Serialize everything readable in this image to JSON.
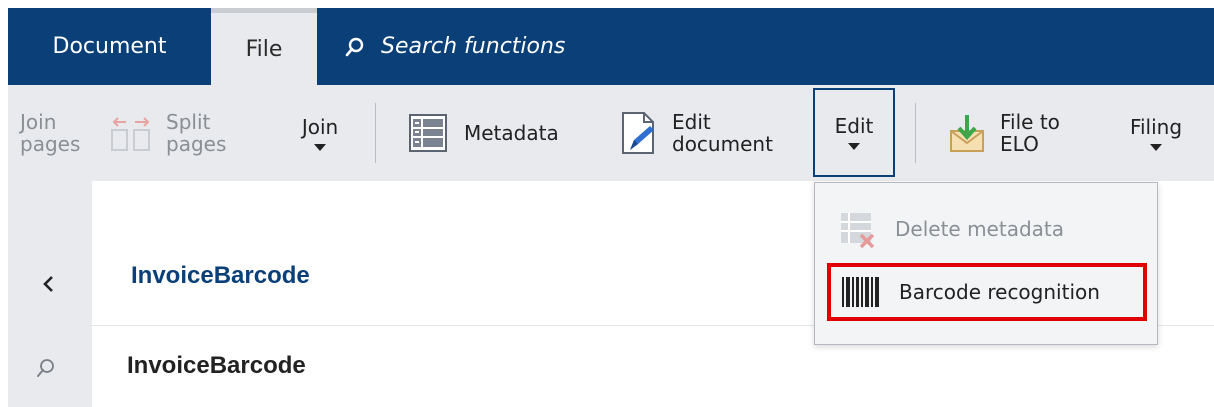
{
  "tabs": {
    "document": "Document",
    "file": "File"
  },
  "search": {
    "label": "Search functions"
  },
  "ribbon": {
    "join_pages_line1": "Join",
    "join_pages_line2": "pages",
    "split_pages_line1": "Split",
    "split_pages_line2": "pages",
    "join": "Join",
    "metadata": "Metadata",
    "edit_document_line1": "Edit",
    "edit_document_line2": "document",
    "edit": "Edit",
    "file_to_elo_line1": "File to",
    "file_to_elo_line2": "ELO",
    "filing": "Filing"
  },
  "dropdown": {
    "delete_metadata": "Delete metadata",
    "barcode_recognition": "Barcode recognition"
  },
  "content": {
    "title_blue": "InvoiceBarcode",
    "title_dark": "InvoiceBarcode"
  },
  "colors": {
    "brand": "#0a3f78",
    "ribbon_bg": "#e8eaed",
    "highlight": "#e10000"
  }
}
